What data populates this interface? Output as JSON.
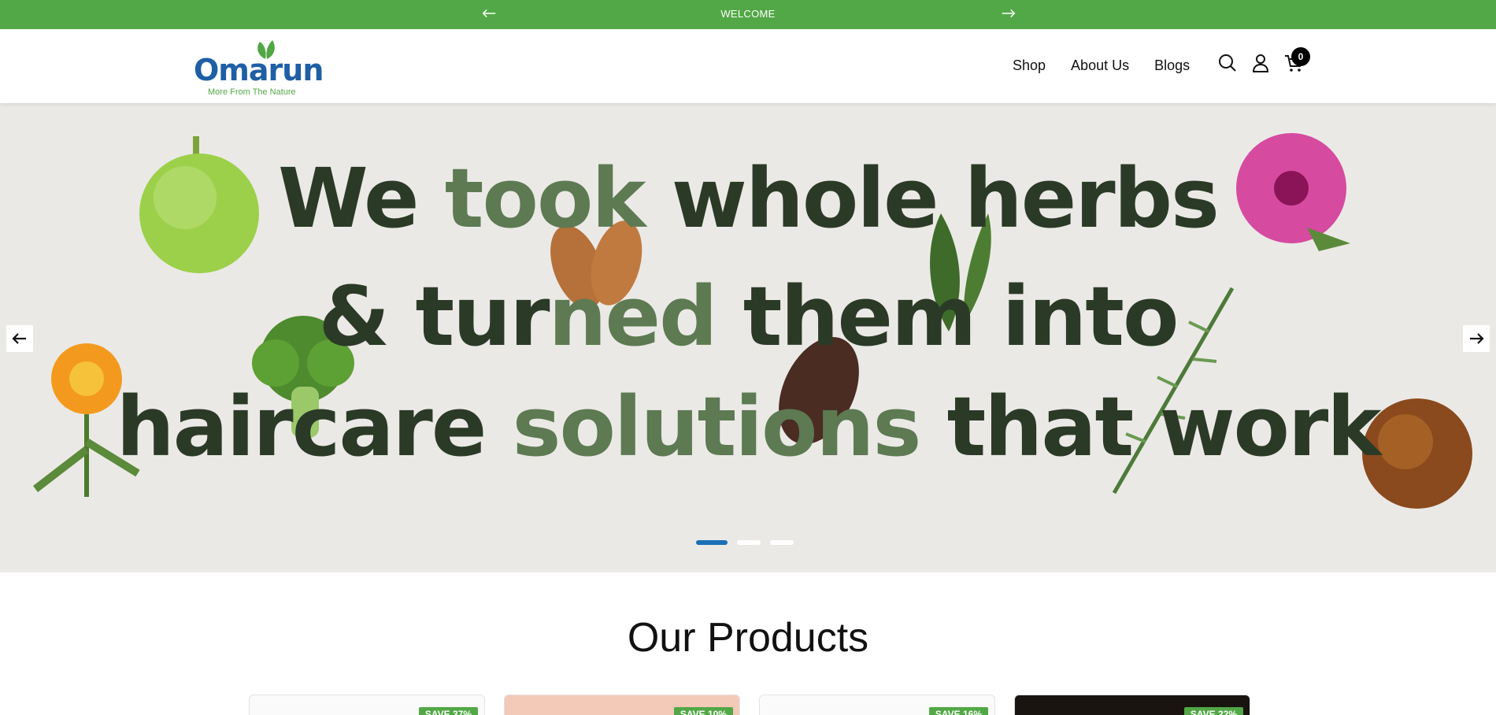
{
  "announcement": {
    "message": "WELCOME"
  },
  "brand": {
    "name": "Omarun",
    "tagline": "More From The Nature",
    "primary_color": "#1e5fa6",
    "accent_color": "#52a846"
  },
  "nav": {
    "items": [
      {
        "label": "Shop"
      },
      {
        "label": "About Us"
      },
      {
        "label": "Blogs"
      }
    ]
  },
  "cart": {
    "count": "0"
  },
  "hero": {
    "line1": "We took whole herbs",
    "line2": "& turned them into",
    "line3a": "haircare ",
    "line3b": "solutions",
    "line3c": " that work",
    "line1a": "We ",
    "line1b": "took",
    "line1c": " whole herbs",
    "line2a": "& tur",
    "line2b": "ned",
    "line2c": " them into",
    "slides": 3,
    "active_slide": 1
  },
  "products": {
    "title": "Our Products",
    "cards": [
      {
        "badge": "SAVE 37%"
      },
      {
        "badge": "SAVE 10%"
      },
      {
        "badge": "SAVE 16%"
      },
      {
        "badge": "SAVE 22%"
      }
    ]
  }
}
